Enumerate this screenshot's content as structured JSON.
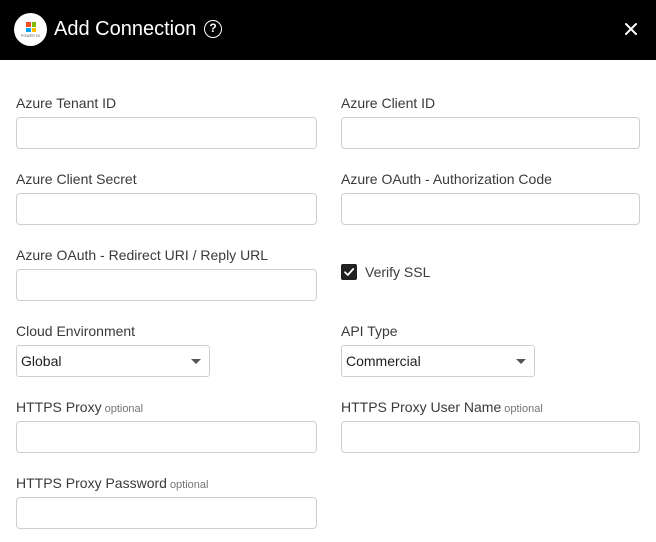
{
  "header": {
    "title": "Add Connection",
    "logo_caption": "POWER BI",
    "logo_colors": [
      "#f25022",
      "#7fba00",
      "#00a4ef",
      "#ffb900"
    ],
    "help_icon": "help-circle-icon",
    "close_icon": "close-icon"
  },
  "fields": {
    "tenant_id": {
      "label": "Azure Tenant ID",
      "value": ""
    },
    "client_id": {
      "label": "Azure Client ID",
      "value": ""
    },
    "client_secret": {
      "label": "Azure Client Secret",
      "value": ""
    },
    "auth_code": {
      "label": "Azure OAuth - Authorization Code",
      "value": ""
    },
    "redirect_uri": {
      "label": "Azure OAuth - Redirect URI / Reply URL",
      "value": ""
    },
    "verify_ssl": {
      "label": "Verify SSL",
      "checked": true
    },
    "cloud_env": {
      "label": "Cloud Environment",
      "value": "Global"
    },
    "api_type": {
      "label": "API Type",
      "value": "Commercial"
    },
    "https_proxy": {
      "label": "HTTPS Proxy",
      "optional": "optional",
      "value": ""
    },
    "proxy_user": {
      "label": "HTTPS Proxy User Name",
      "optional": "optional",
      "value": ""
    },
    "proxy_password": {
      "label": "HTTPS Proxy Password",
      "optional": "optional",
      "value": ""
    }
  }
}
